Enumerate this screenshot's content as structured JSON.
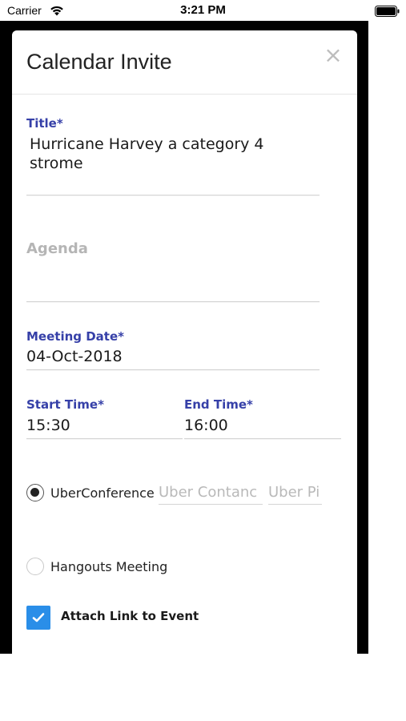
{
  "status_bar": {
    "carrier": "Carrier",
    "time": "3:21 PM"
  },
  "modal": {
    "title": "Calendar Invite",
    "close_symbol": "×"
  },
  "form": {
    "title_label": "Title*",
    "title_value_line1": "Hurricane Harvey a category 4",
    "title_value_line2": "strome",
    "agenda_label": "Agenda",
    "meeting_date_label": "Meeting Date*",
    "meeting_date_value": "04-Oct-2018",
    "start_time_label": "Start Time*",
    "start_time_value": "15:30",
    "end_time_label": "End Time*",
    "end_time_value": "16:00",
    "uberconference_label": "UberConference",
    "uber_contact_placeholder": "Uber Contanc",
    "uber_pin_placeholder": "Uber Pi",
    "hangouts_label": "Hangouts Meeting",
    "attach_link_label": "Attach Link to Event",
    "selected_option": "UberConference",
    "attach_link_checked": true
  },
  "colors": {
    "label_blue": "#3640a8",
    "checkbox_blue": "#2a8ee8",
    "placeholder_gray": "#b5b5b5"
  },
  "icons": {
    "wifi": "wifi-icon",
    "battery": "battery-icon",
    "close": "close-icon",
    "check": "checkmark-icon"
  }
}
